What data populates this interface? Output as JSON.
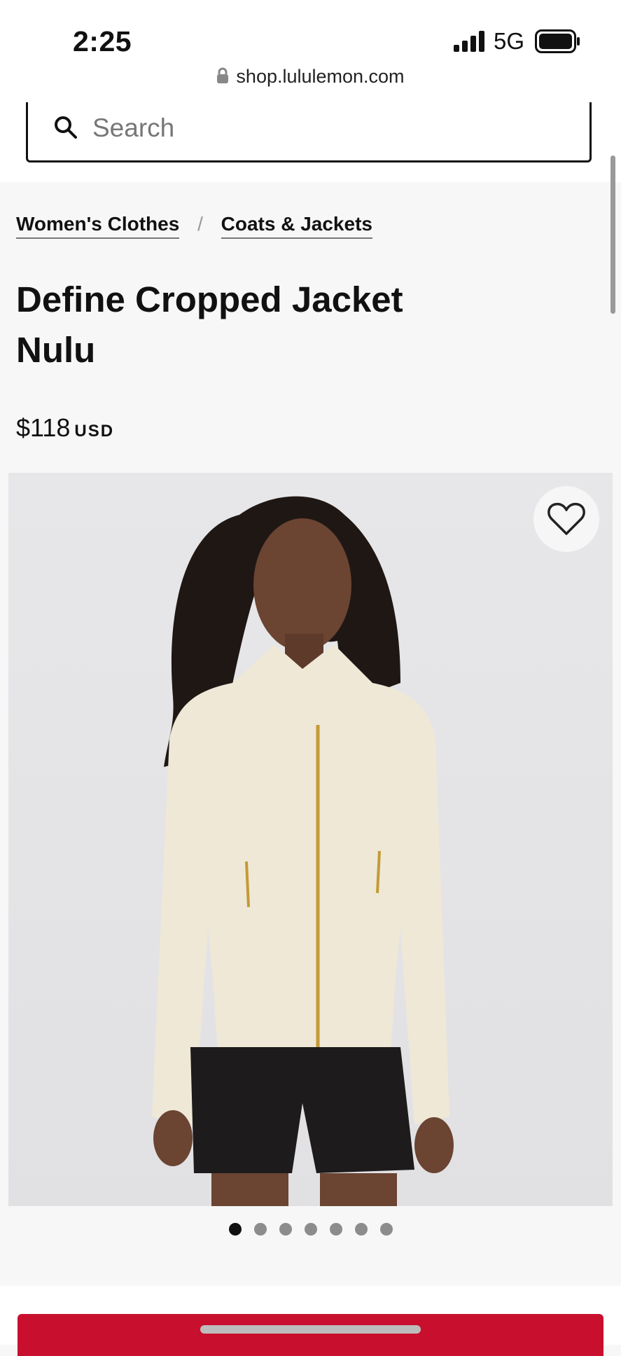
{
  "status_bar": {
    "time": "2:25",
    "network": "5G",
    "icons": [
      "signal-icon",
      "battery-icon"
    ]
  },
  "browser": {
    "url": "shop.lululemon.com",
    "lock_icon": "lock-icon"
  },
  "search": {
    "placeholder": "Search",
    "icon": "search-icon"
  },
  "breadcrumb": {
    "items": [
      {
        "label": "Women's Clothes"
      },
      {
        "label": "Coats & Jackets"
      }
    ],
    "separator": "/"
  },
  "product": {
    "title_line1": "Define Cropped Jacket",
    "title_line2": "Nulu",
    "price": "$118",
    "currency": "USD",
    "image": {
      "alt": "Woman wearing a cream zip-up cropped jacket and black shorts",
      "wishlist_icon": "heart-icon",
      "carousel_count": 7,
      "carousel_active_index": 0
    }
  },
  "colors": {
    "accent": "#c8102e",
    "text": "#111111",
    "background": "#f7f7f7"
  }
}
